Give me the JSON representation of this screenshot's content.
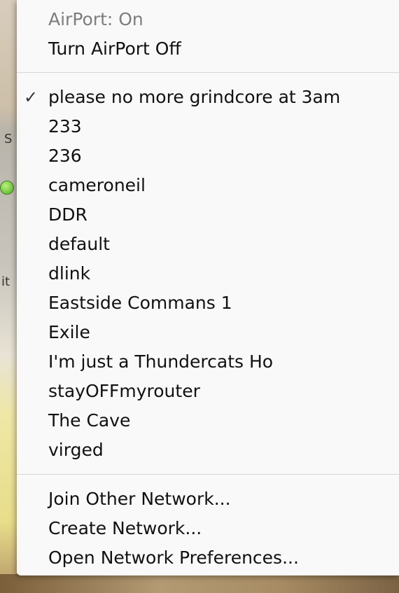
{
  "airport": {
    "status": "AirPort: On",
    "toggle": "Turn AirPort Off"
  },
  "selected_network": "please no more grindcore at 3am",
  "checkmark": "✓",
  "networks": [
    "please no more grindcore at 3am",
    "233",
    "236",
    "cameroneil",
    "DDR",
    "default",
    "dlink",
    "Eastside Commans 1",
    "Exile",
    "I'm just a Thundercats Ho",
    "stayOFFmyrouter",
    "The Cave",
    "virged"
  ],
  "actions": {
    "join": "Join Other Network...",
    "create": "Create Network...",
    "preferences": "Open Network Preferences..."
  },
  "background_fragments": {
    "s": "S",
    "it": "it"
  }
}
